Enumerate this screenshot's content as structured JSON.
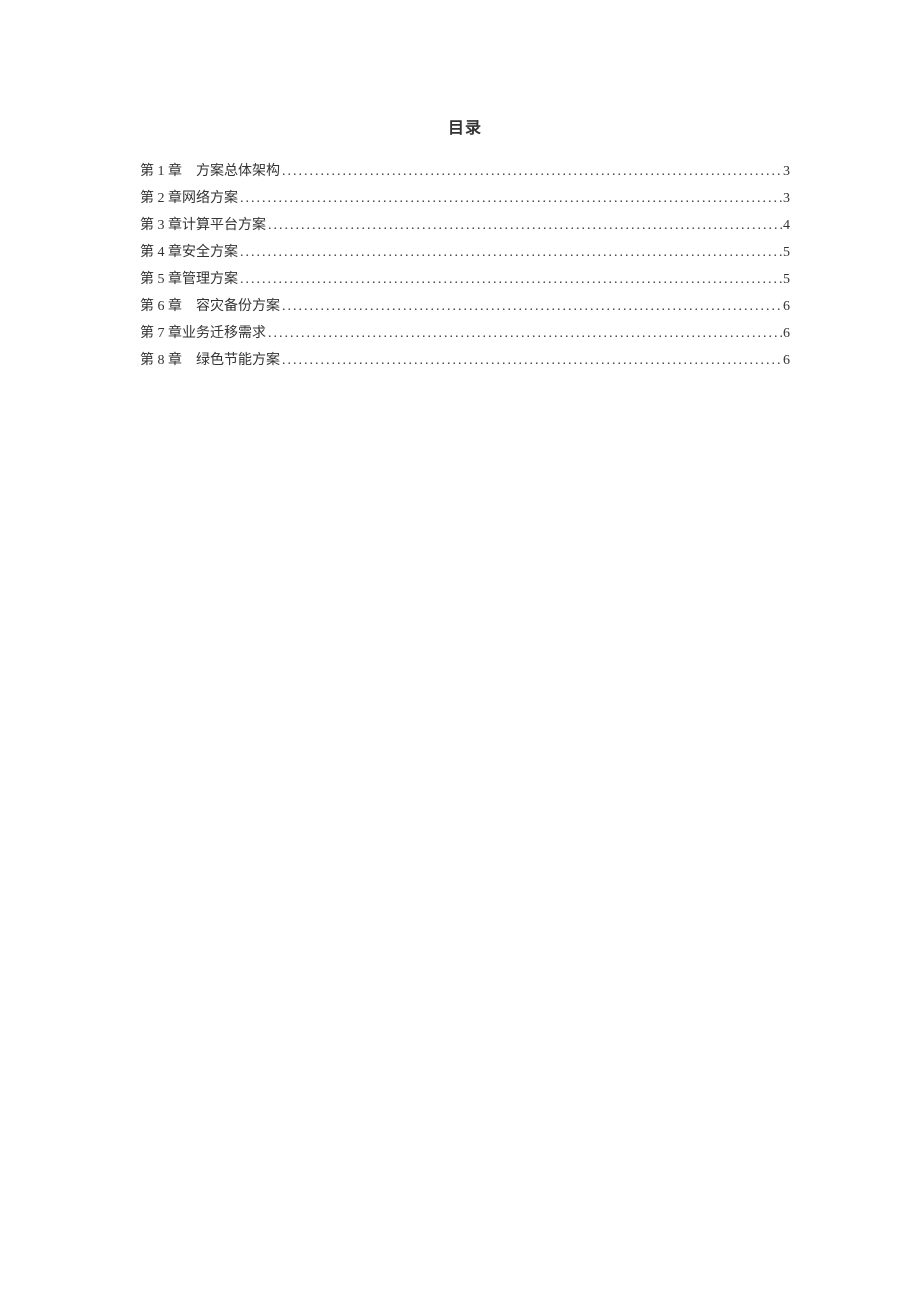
{
  "toc": {
    "title": "目录",
    "entries": [
      {
        "label": "第 1 章　方案总体架构",
        "page": "3"
      },
      {
        "label": "第 2 章网络方案",
        "page": "3"
      },
      {
        "label": "第 3 章计算平台方案",
        "page": "4"
      },
      {
        "label": "第 4 章安全方案",
        "page": "5"
      },
      {
        "label": "第 5 章管理方案",
        "page": "5"
      },
      {
        "label": "第 6 章　容灾备份方案",
        "page": "6"
      },
      {
        "label": "第 7 章业务迁移需求",
        "page": "6"
      },
      {
        "label": "第 8 章　绿色节能方案",
        "page": "6"
      }
    ]
  }
}
